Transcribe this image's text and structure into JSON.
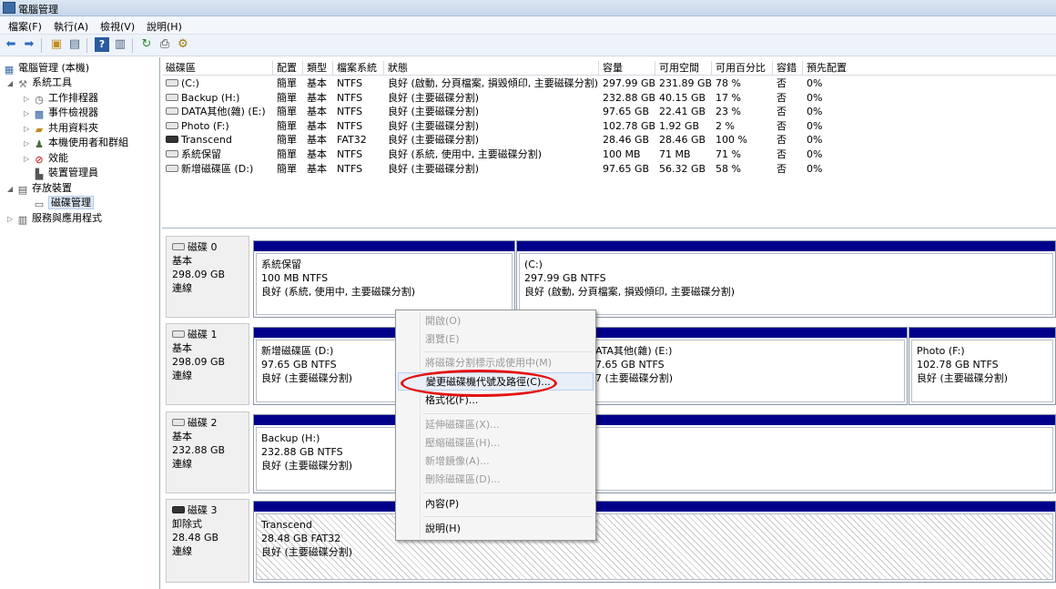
{
  "window": {
    "title": "電腦管理"
  },
  "menu": [
    "檔案(F)",
    "執行(A)",
    "檢視(V)",
    "說明(H)"
  ],
  "toolbar": [
    "back-icon",
    "forward-icon",
    "up-folder-icon",
    "show-hide-tree-icon",
    "help-icon",
    "properties-icon",
    "refresh-icon",
    "export-icon",
    "settings-icon"
  ],
  "tree": [
    {
      "label": "電腦管理 (本機)",
      "icon": "computer-management-icon"
    },
    {
      "label": "系統工具",
      "icon": "tools-icon"
    },
    {
      "label": "工作排程器",
      "icon": "clock-icon"
    },
    {
      "label": "事件檢視器",
      "icon": "event-viewer-icon"
    },
    {
      "label": "共用資料夾",
      "icon": "shared-folder-icon"
    },
    {
      "label": "本機使用者和群組",
      "icon": "users-icon"
    },
    {
      "label": "效能",
      "icon": "performance-icon"
    },
    {
      "label": "裝置管理員",
      "icon": "device-manager-icon"
    },
    {
      "label": "存放裝置",
      "icon": "storage-icon"
    },
    {
      "label": "磁碟管理",
      "icon": "disk-management-icon"
    },
    {
      "label": "服務與應用程式",
      "icon": "services-icon"
    }
  ],
  "volumes": {
    "headers": [
      "磁碟區",
      "配置",
      "類型",
      "檔案系統",
      "狀態",
      "容量",
      "可用空間",
      "可用百分比",
      "容錯",
      "預先配置"
    ],
    "rows": [
      [
        "(C:)",
        "簡單",
        "基本",
        "NTFS",
        "良好 (啟動, 分頁檔案, 損毀傾印, 主要磁碟分割)",
        "297.99 GB",
        "231.89 GB",
        "78 %",
        "否",
        "0%"
      ],
      [
        "Backup (H:)",
        "簡單",
        "基本",
        "NTFS",
        "良好 (主要磁碟分割)",
        "232.88 GB",
        "40.15 GB",
        "17 %",
        "否",
        "0%"
      ],
      [
        "DATA其他(雜) (E:)",
        "簡單",
        "基本",
        "NTFS",
        "良好 (主要磁碟分割)",
        "97.65 GB",
        "22.41 GB",
        "23 %",
        "否",
        "0%"
      ],
      [
        "Photo (F:)",
        "簡單",
        "基本",
        "NTFS",
        "良好 (主要磁碟分割)",
        "102.78 GB",
        "1.92 GB",
        "2 %",
        "否",
        "0%"
      ],
      [
        "Transcend",
        "簡單",
        "基本",
        "FAT32",
        "良好 (主要磁碟分割)",
        "28.46 GB",
        "28.46 GB",
        "100 %",
        "否",
        "0%"
      ],
      [
        "系統保留",
        "簡單",
        "基本",
        "NTFS",
        "良好 (系統, 使用中, 主要磁碟分割)",
        "100 MB",
        "71 MB",
        "71 %",
        "否",
        "0%"
      ],
      [
        "新增磁碟區 (D:)",
        "簡單",
        "基本",
        "NTFS",
        "良好 (主要磁碟分割)",
        "97.65 GB",
        "56.32 GB",
        "58 %",
        "否",
        "0%"
      ]
    ]
  },
  "disks": [
    {
      "name": "磁碟 0",
      "type": "基本",
      "size": "298.09 GB",
      "status": "連線",
      "partitions": [
        {
          "name": "系統保留",
          "fs": "100 MB NTFS",
          "status": "良好 (系統, 使用中, 主要磁碟分割)"
        },
        {
          "name": "(C:)",
          "fs": "297.99 GB NTFS",
          "status": "良好 (啟動, 分頁檔案, 損毀傾印, 主要磁碟分割)"
        }
      ]
    },
    {
      "name": "磁碟 1",
      "type": "基本",
      "size": "298.09 GB",
      "status": "連線",
      "partitions": [
        {
          "name": "新增磁碟區 (D:)",
          "fs": "97.65 GB NTFS",
          "status": "良好 (主要磁碟分割)"
        },
        {
          "name": "ATA其他(雜) (E:)",
          "fs": "7.65 GB NTFS",
          "status": "7 (主要磁碟分割)"
        },
        {
          "name": "Photo (F:)",
          "fs": "102.78 GB NTFS",
          "status": "良好 (主要磁碟分割)"
        }
      ]
    },
    {
      "name": "磁碟 2",
      "type": "基本",
      "size": "232.88 GB",
      "status": "連線",
      "partitions": [
        {
          "name": "Backup (H:)",
          "fs": "232.88 GB NTFS",
          "status": "良好 (主要磁碟分割)"
        }
      ]
    },
    {
      "name": "磁碟 3",
      "type": "卸除式",
      "size": "28.48 GB",
      "status": "連線",
      "partitions": [
        {
          "name": "Transcend",
          "fs": "28.48 GB FAT32",
          "status": "良好 (主要磁碟分割)"
        }
      ]
    }
  ],
  "context_menu": {
    "items": [
      {
        "label": "開啟(O)",
        "enabled": false
      },
      {
        "label": "瀏覽(E)",
        "enabled": false
      },
      {
        "label": "將磁碟分割標示成使用中(M)",
        "enabled": false
      },
      {
        "label": "變更磁碟機代號及路徑(C)...",
        "enabled": true
      },
      {
        "label": "格式化(F)...",
        "enabled": true
      },
      {
        "label": "延伸磁碟區(X)...",
        "enabled": false
      },
      {
        "label": "壓縮磁碟區(H)...",
        "enabled": false
      },
      {
        "label": "新增鏡像(A)...",
        "enabled": false
      },
      {
        "label": "刪除磁碟區(D)...",
        "enabled": false
      },
      {
        "label": "內容(P)",
        "enabled": true
      },
      {
        "label": "說明(H)",
        "enabled": true
      }
    ],
    "annotation_color": "#e31111"
  },
  "colors": {
    "partition_bar": "#00008b",
    "selection": "#dde9f7"
  }
}
